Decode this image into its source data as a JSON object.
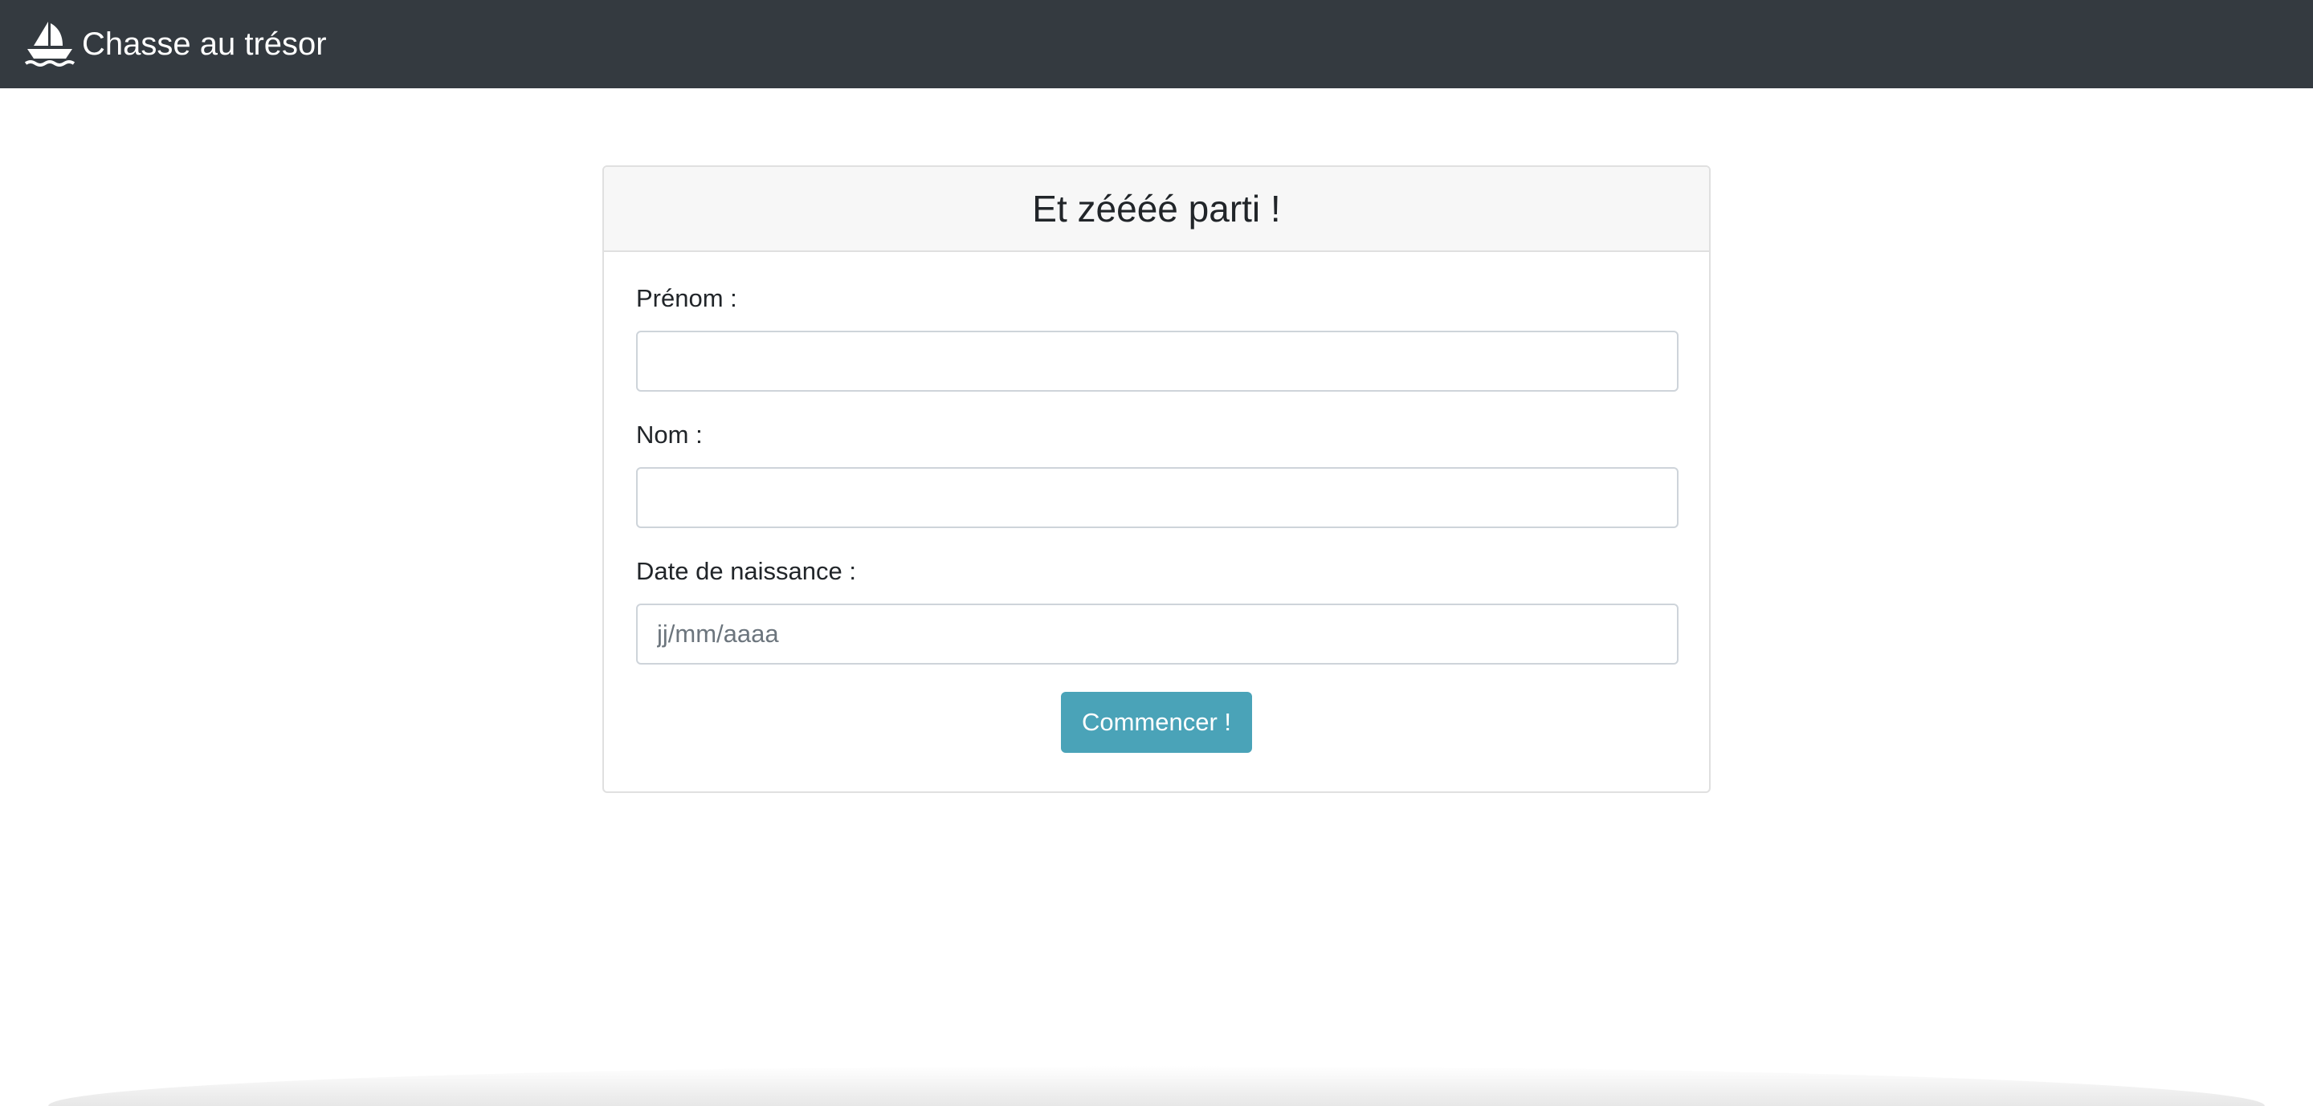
{
  "navbar": {
    "brand_icon": "ship-icon",
    "brand_label": "Chasse au trésor"
  },
  "card": {
    "title": "Et zéééé parti !"
  },
  "form": {
    "first_name_label": "Prénom :",
    "first_name_value": "",
    "last_name_label": "Nom :",
    "last_name_value": "",
    "birthdate_label": "Date de naissance :",
    "birthdate_value": "",
    "birthdate_placeholder": "jj/mm/aaaa",
    "submit_label": "Commencer !"
  },
  "colors": {
    "navbar_bg": "#343a40",
    "button_bg": "#4aa3b8",
    "card_header_bg": "#f7f7f7"
  }
}
